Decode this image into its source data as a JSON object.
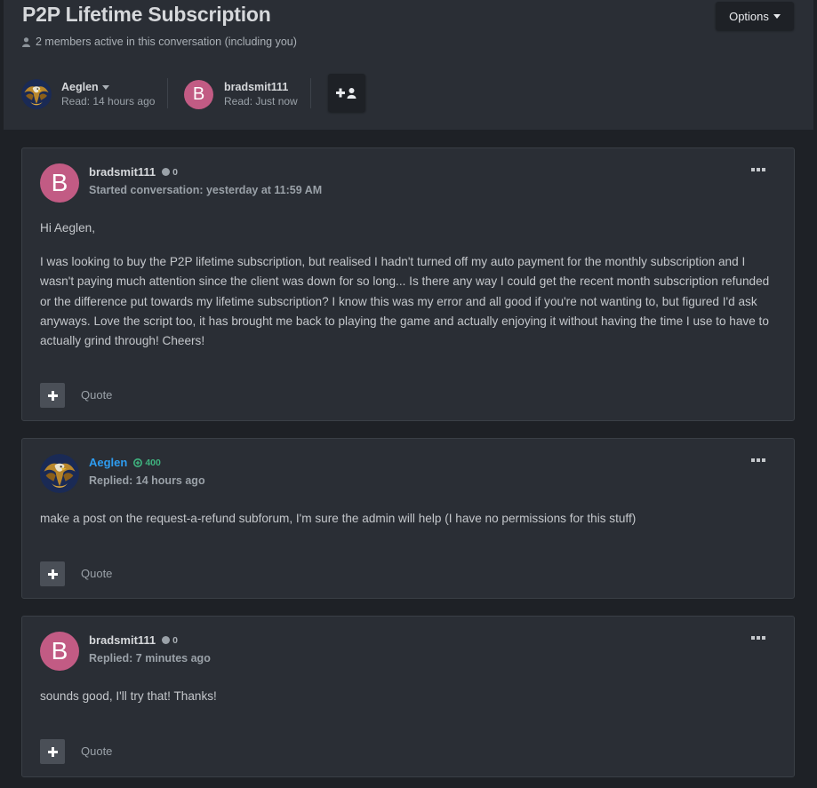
{
  "conversation": {
    "title": "P2P Lifetime Subscription",
    "members_text": "2 members active in this conversation (including you)",
    "options_label": "Options"
  },
  "participants": [
    {
      "name": "Aeglen",
      "read": "Read: 14 hours ago",
      "avatar": "eagle-avatar"
    },
    {
      "name": "bradsmit111",
      "read": "Read: Just now",
      "avatar_letter": "B"
    }
  ],
  "posts": [
    {
      "author": "bradsmit111",
      "avatar_letter": "B",
      "reputation": "0",
      "meta": "Started conversation: yesterday at 11:59 AM",
      "paragraphs": [
        "Hi Aeglen,",
        "I was looking to buy the P2P lifetime subscription, but realised I hadn't turned off my auto payment for the monthly subscription and I wasn't paying much attention since the client was down for so long... Is there any way I could get the recent month subscription refunded or the difference put towards my lifetime subscription? I know this was my error and all good if you're not wanting to, but figured I'd ask anyways. Love the script too, it has brought me back to playing the game and actually enjoying it without having the time I use to have to actually grind through! Cheers!"
      ],
      "quote_label": "Quote"
    },
    {
      "author": "Aeglen",
      "avatar": "eagle-avatar",
      "reputation": "400",
      "meta": "Replied: 14 hours ago",
      "paragraphs": [
        "make a post on the request-a-refund subforum, I'm sure the admin will help (I have no permissions for this stuff)"
      ],
      "quote_label": "Quote"
    },
    {
      "author": "bradsmit111",
      "avatar_letter": "B",
      "reputation": "0",
      "meta": "Replied: 7 minutes ago",
      "paragraphs": [
        "sounds good, I'll try that! Thanks!"
      ],
      "quote_label": "Quote"
    }
  ],
  "colors": {
    "background": "#1e2126",
    "panel": "#2a2e35",
    "avatar_pink": "#c25b84",
    "staff_blue": "#2e9cf0",
    "rep_green": "#3fb37f"
  }
}
